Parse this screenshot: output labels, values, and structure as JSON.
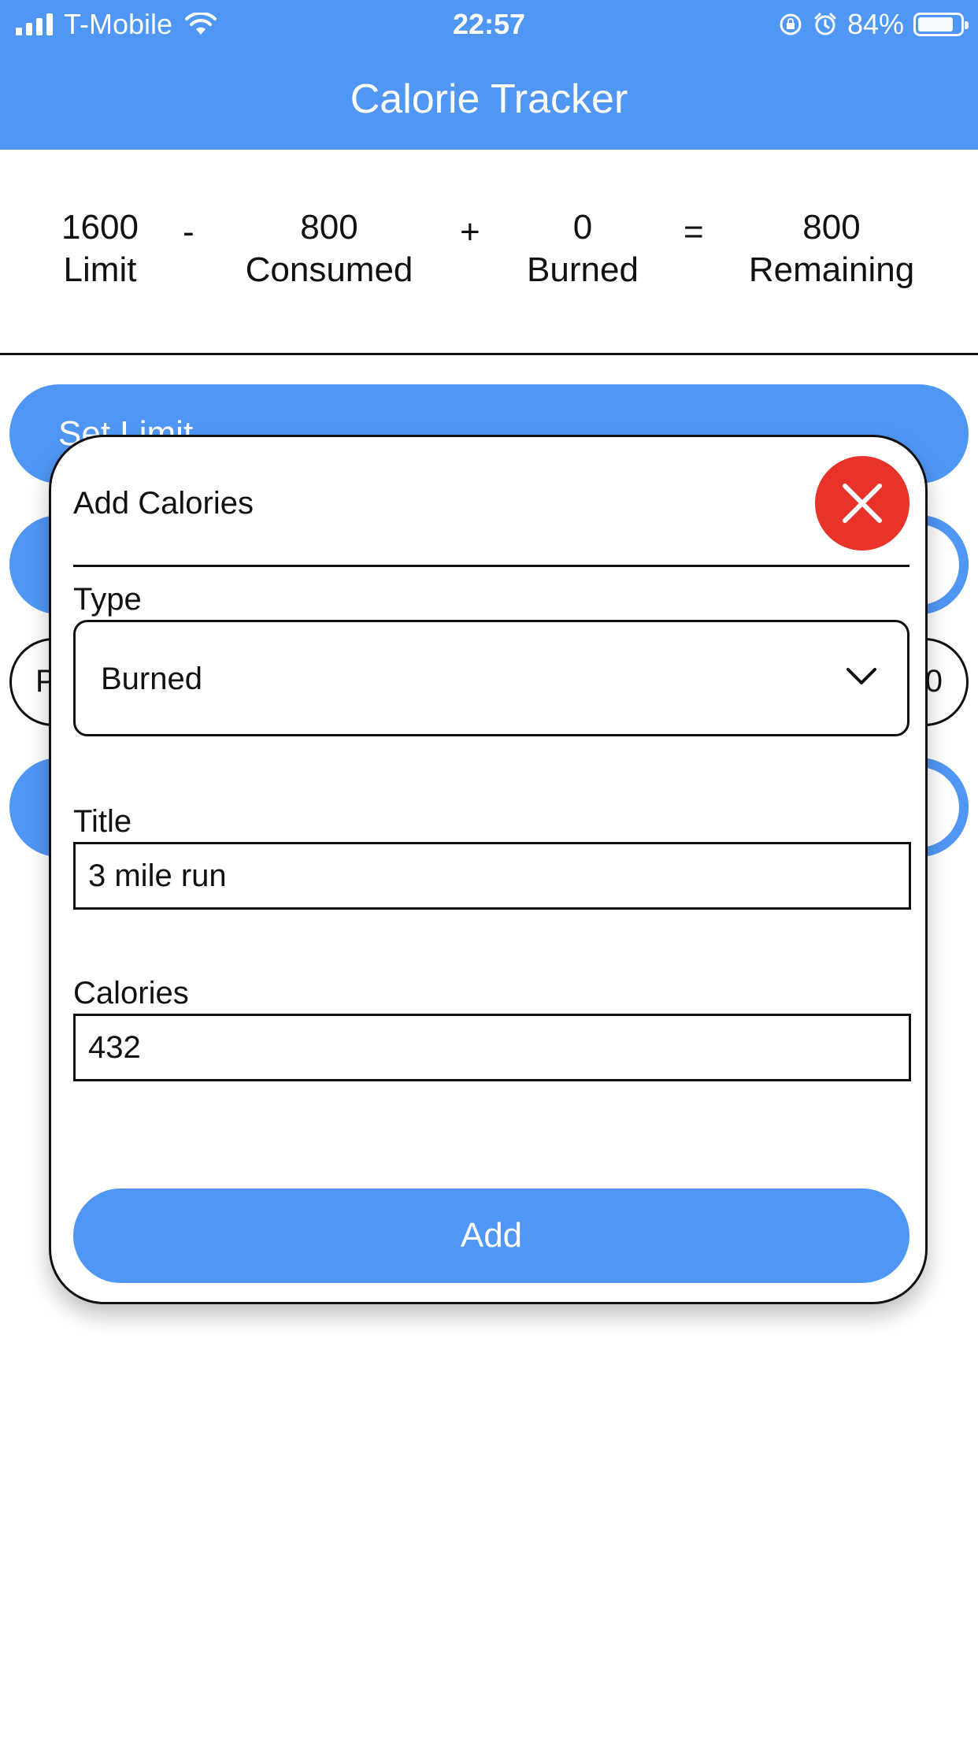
{
  "status_bar": {
    "carrier": "T-Mobile",
    "time": "22:57",
    "battery_percent_label": "84%",
    "battery_level": 0.84,
    "icons": [
      "signal-icon",
      "wifi-icon",
      "rotation-lock-icon",
      "alarm-icon",
      "battery-icon"
    ]
  },
  "header": {
    "title": "Calorie Tracker",
    "color": "#5097F5"
  },
  "summary": {
    "limit": {
      "value": "1600",
      "label": "Limit"
    },
    "op_minus": "-",
    "consumed": {
      "value": "800",
      "label": "Consumed"
    },
    "op_plus": "+",
    "burned": {
      "value": "0",
      "label": "Burned"
    },
    "op_equals": "=",
    "remaining": {
      "value": "800",
      "label": "Remaining"
    }
  },
  "background": {
    "set_limit_label": "Set Limit",
    "outline_left_fragment": "P",
    "outline_right_fragment": "0"
  },
  "modal": {
    "title": "Add Calories",
    "close_color": "#E8332A",
    "type_label": "Type",
    "type_value": "Burned",
    "title_label": "Title",
    "title_value": "3 mile run",
    "calories_label": "Calories",
    "calories_value": "432",
    "add_button_label": "Add"
  }
}
